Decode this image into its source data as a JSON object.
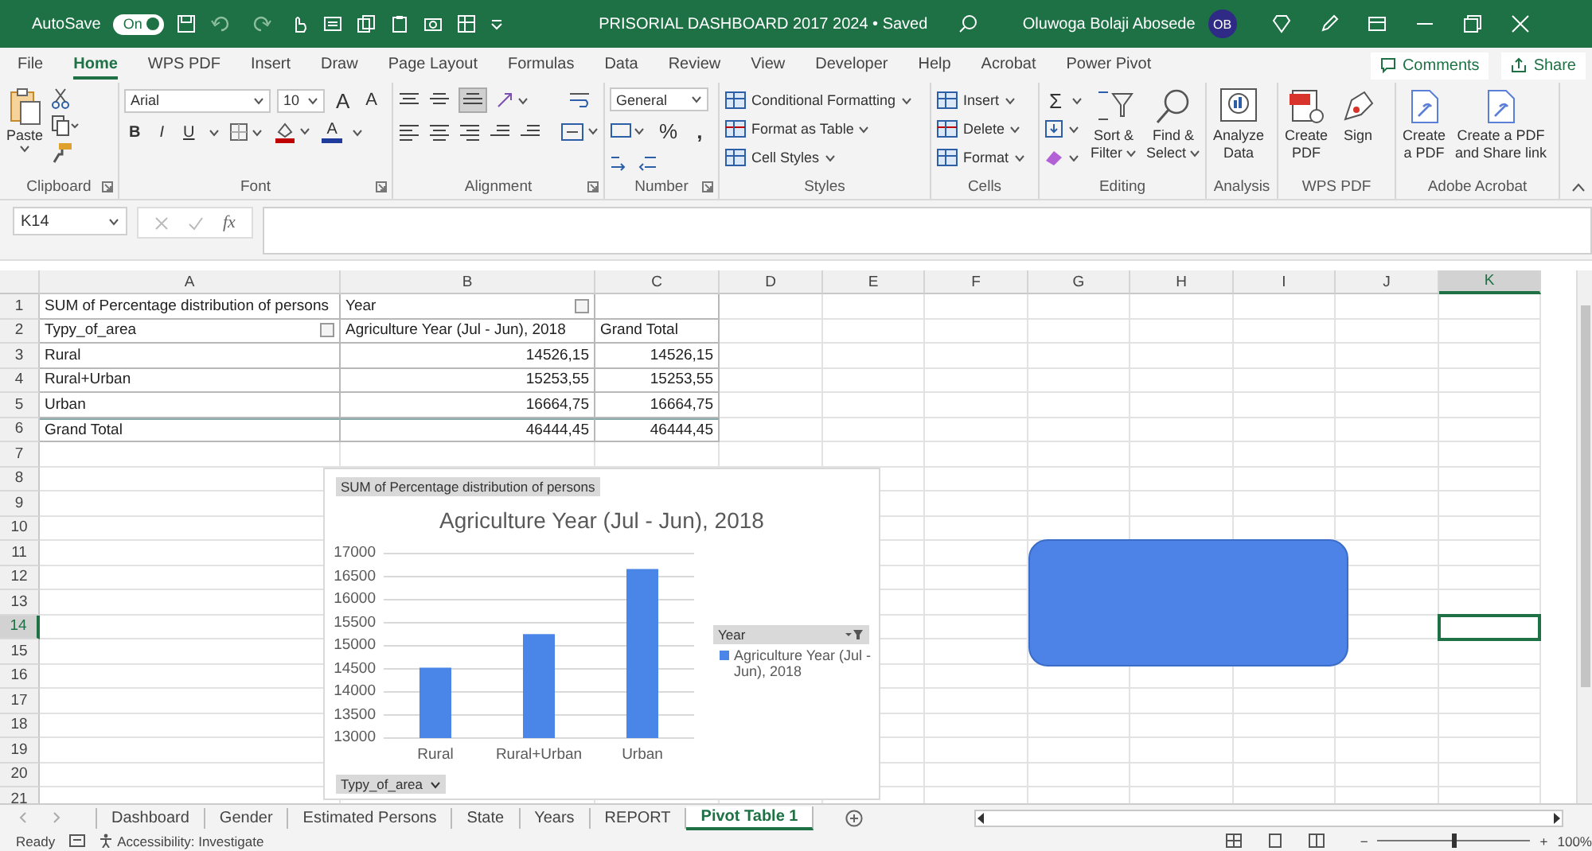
{
  "title_bar": {
    "autosave_label": "AutoSave",
    "autosave_toggle": {
      "label": "On",
      "on": true
    },
    "document_title": "PRISORIAL DASHBOARD 2017 2024 • Saved",
    "user_name": "Oluwoga Bolaji Abosede",
    "user_initials": "OB"
  },
  "menu_tabs": [
    {
      "label": "File",
      "selected": false
    },
    {
      "label": "Home",
      "selected": true
    },
    {
      "label": "WPS PDF",
      "selected": false
    },
    {
      "label": "Insert",
      "selected": false
    },
    {
      "label": "Draw",
      "selected": false
    },
    {
      "label": "Page Layout",
      "selected": false
    },
    {
      "label": "Formulas",
      "selected": false
    },
    {
      "label": "Data",
      "selected": false
    },
    {
      "label": "Review",
      "selected": false
    },
    {
      "label": "View",
      "selected": false
    },
    {
      "label": "Developer",
      "selected": false
    },
    {
      "label": "Help",
      "selected": false
    },
    {
      "label": "Acrobat",
      "selected": false
    },
    {
      "label": "Power Pivot",
      "selected": false
    }
  ],
  "comments_button": "Comments",
  "share_button": "Share",
  "ribbon": [
    {
      "kind": "clipboard",
      "label": "Clipboard",
      "launcher": true,
      "paste": "Paste"
    },
    {
      "kind": "font",
      "label": "Font",
      "launcher": true,
      "font_name": "Arial",
      "font_size": "10",
      "size_buttons": [
        "A",
        "A"
      ],
      "style_buttons": [
        "B",
        "I",
        "U"
      ],
      "color_button": "A"
    },
    {
      "kind": "alignment",
      "label": "Alignment",
      "launcher": true
    },
    {
      "kind": "number",
      "label": "Number",
      "launcher": true,
      "format": "General",
      "symbols": [
        "%",
        ","
      ]
    },
    {
      "kind": "list",
      "label": "Styles",
      "launcher": false,
      "items": [
        "Conditional Formatting",
        "Format as Table",
        "Cell Styles"
      ]
    },
    {
      "kind": "list",
      "label": "Cells",
      "launcher": false,
      "items": [
        "Insert",
        "Delete",
        "Format"
      ]
    },
    {
      "kind": "editing",
      "label": "Editing",
      "launcher": false,
      "sum": "Σ",
      "buttons": [
        {
          "lines": [
            "Sort &",
            "Filter"
          ]
        },
        {
          "lines": [
            "Find &",
            "Select"
          ]
        }
      ]
    },
    {
      "kind": "large",
      "label": "Analysis",
      "launcher": false,
      "buttons": [
        {
          "lines": [
            "Analyze",
            "Data"
          ]
        }
      ]
    },
    {
      "kind": "large",
      "label": "WPS PDF",
      "launcher": false,
      "buttons": [
        {
          "lines": [
            "Create",
            "PDF"
          ]
        },
        {
          "lines": [
            "Sign"
          ]
        }
      ]
    },
    {
      "kind": "large",
      "label": "Adobe Acrobat",
      "launcher": false,
      "buttons": [
        {
          "lines": [
            "Create",
            "a PDF"
          ]
        },
        {
          "lines": [
            "Create a PDF",
            "and Share link"
          ]
        }
      ]
    }
  ],
  "formula_bar": {
    "name_box": "K14",
    "function_label": "fx"
  },
  "columns": [
    {
      "label": "A",
      "selected": false
    },
    {
      "label": "B",
      "selected": false
    },
    {
      "label": "C",
      "selected": false
    },
    {
      "label": "D",
      "selected": false
    },
    {
      "label": "E",
      "selected": false
    },
    {
      "label": "F",
      "selected": false
    },
    {
      "label": "G",
      "selected": false
    },
    {
      "label": "H",
      "selected": false
    },
    {
      "label": "I",
      "selected": false
    },
    {
      "label": "J",
      "selected": false
    },
    {
      "label": "K",
      "selected": true
    }
  ],
  "row_numbers": [
    {
      "label": "1",
      "selected": false
    },
    {
      "label": "2",
      "selected": false
    },
    {
      "label": "3",
      "selected": false
    },
    {
      "label": "4",
      "selected": false
    },
    {
      "label": "5",
      "selected": false
    },
    {
      "label": "6",
      "selected": false
    },
    {
      "label": "7",
      "selected": false
    },
    {
      "label": "8",
      "selected": false
    },
    {
      "label": "9",
      "selected": false
    },
    {
      "label": "10",
      "selected": false
    },
    {
      "label": "11",
      "selected": false
    },
    {
      "label": "12",
      "selected": false
    },
    {
      "label": "13",
      "selected": false
    },
    {
      "label": "14",
      "selected": true
    },
    {
      "label": "15",
      "selected": false
    },
    {
      "label": "16",
      "selected": false
    },
    {
      "label": "17",
      "selected": false
    },
    {
      "label": "18",
      "selected": false
    },
    {
      "label": "19",
      "selected": false
    },
    {
      "label": "20",
      "selected": false
    },
    {
      "label": "21",
      "selected": false
    }
  ],
  "pivot_table": {
    "rows": [
      {
        "cells": [
          {
            "text": "SUM of Percentage distribution of persons",
            "button": false
          },
          {
            "text": "Year",
            "button": true
          }
        ]
      },
      {
        "cells": [
          {
            "text": "Typy_of_area",
            "button": true
          },
          {
            "text": "Agriculture Year (Jul - Jun), 2018",
            "button": false
          },
          {
            "text": "Grand Total",
            "button": false
          }
        ]
      },
      {
        "cells": [
          {
            "text": "Rural",
            "button": false
          },
          {
            "text": "14526,15",
            "button": false
          },
          {
            "text": "14526,15",
            "button": false
          }
        ]
      },
      {
        "cells": [
          {
            "text": "Rural+Urban",
            "button": false
          },
          {
            "text": "15253,55",
            "button": false
          },
          {
            "text": "15253,55",
            "button": false
          }
        ]
      },
      {
        "cells": [
          {
            "text": "Urban",
            "button": false
          },
          {
            "text": "16664,75",
            "button": false
          },
          {
            "text": "16664,75",
            "button": false
          }
        ]
      },
      {
        "cells": [
          {
            "text": "Grand Total",
            "button": false
          },
          {
            "text": "46444,45",
            "button": false
          },
          {
            "text": "46444,45",
            "button": false
          }
        ]
      }
    ]
  },
  "pivot_chart": {
    "value_field_button": "SUM of Percentage distribution of persons",
    "axis_field_button": "Typy_of_area",
    "legend_field_button": "Year",
    "chart_data": {
      "type": "bar",
      "grid": true,
      "title": "Agriculture Year (Jul - Jun), 2018",
      "categories": [
        "Rural",
        "Rural+Urban",
        "Urban"
      ],
      "series": [
        {
          "name": "Agriculture Year (Jul - Jun), 2018",
          "color": "#4a86e8",
          "values": [
            14526.15,
            15253.55,
            16664.75
          ]
        }
      ],
      "ylim": [
        13000,
        17000
      ],
      "yticks": [
        13000,
        13500,
        14000,
        14500,
        15000,
        15500,
        16000,
        16500,
        17000
      ]
    }
  },
  "shapes": [
    {
      "kind": "rounded_rectangle"
    }
  ],
  "sheet_tabs": [
    {
      "label": "Dashboard",
      "selected": false
    },
    {
      "label": "Gender",
      "selected": false
    },
    {
      "label": "Estimated Persons",
      "selected": false
    },
    {
      "label": "State",
      "selected": false
    },
    {
      "label": "Years",
      "selected": false
    },
    {
      "label": "REPORT",
      "selected": false
    },
    {
      "label": "Pivot Table 1",
      "selected": true
    }
  ],
  "status_bar": {
    "status": "Ready",
    "accessibility": "Accessibility: Investigate",
    "zoom_minus": "−",
    "zoom_plus": "+",
    "zoom": {
      "level": 0.5
    },
    "zoom_percent": "100%"
  }
}
